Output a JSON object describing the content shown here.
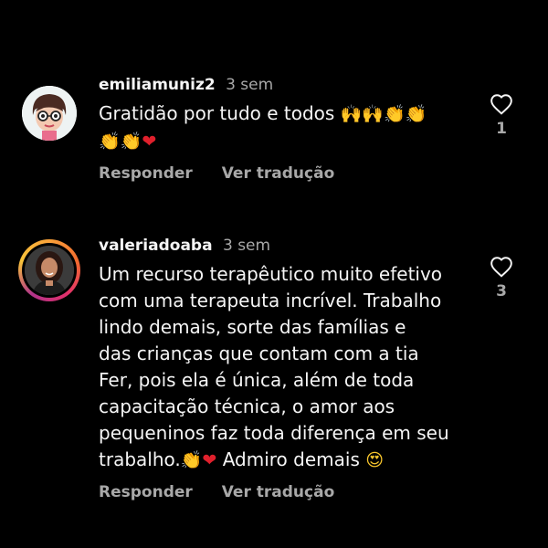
{
  "comments": [
    {
      "username": "emiliamuniz2",
      "time": "3 sem",
      "text_lines": [
        "Gratidão por tudo e todos"
      ],
      "emoji_line1": [
        "raising-hands",
        "raising-hands",
        "clapping-hands",
        "clapping-hands"
      ],
      "emoji_line2": [
        "clapping-hands",
        "clapping-hands",
        "red-heart"
      ],
      "likes": "1",
      "reply_label": "Responder",
      "translate_label": "Ver tradução"
    },
    {
      "username": "valeriadoaba",
      "time": "3 sem",
      "text_lines": [
        "Um recurso terapêutico muito efetivo",
        "com uma terapeuta incrível. Trabalho",
        "lindo demais, sorte das famílias e",
        "das crianças que contam com a tia",
        "Fer, pois ela é única, além de toda",
        "capacitação técnica, o amor aos",
        "pequeninos faz toda diferença em seu",
        "trabalho."
      ],
      "text_tail": "Admiro demais",
      "likes": "3",
      "reply_label": "Responder",
      "translate_label": "Ver tradução"
    }
  ],
  "colors": {
    "background": "#000000",
    "text": "#f5f5f5",
    "muted": "#a8a8a8",
    "story_ring": "#e1306c"
  },
  "icons": {
    "like": "heart-outline-icon"
  }
}
